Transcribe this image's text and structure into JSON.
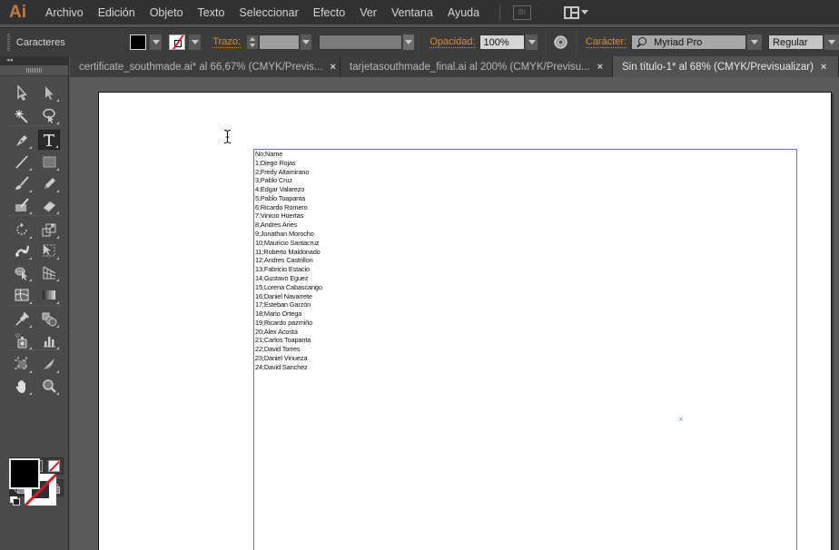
{
  "app": {
    "logo": "Ai",
    "menu": [
      "Archivo",
      "Edición",
      "Objeto",
      "Texto",
      "Seleccionar",
      "Efecto",
      "Ver",
      "Ventana",
      "Ayuda"
    ],
    "bridge_label": "Br",
    "workspace_icon": "workspace-grid-icon"
  },
  "control_bar": {
    "panel_label": "Caracteres",
    "fill_color": "#000000",
    "stroke_color": "none",
    "stroke_label": "Trazo:",
    "stroke_weight": "",
    "brush_profile": "",
    "opacity_label": "Opacidad:",
    "opacity_value": "100%",
    "recolor_icon": "recolor-artwork-icon",
    "character_label": "Carácter:",
    "font_family": "Myriad Pro",
    "font_style": "Regular",
    "accent_color": "#d98a3f"
  },
  "tabs": [
    {
      "label": "certificate_southmade.ai* al 66,67% (CMYK/Previs...",
      "active": false
    },
    {
      "label": "tarjetasouthmade_final.ai al 200% (CMYK/Previsu...",
      "active": false
    },
    {
      "label": "Sin título-1* al 68% (CMYK/Previsualizar)",
      "active": true
    }
  ],
  "tools": {
    "active_tool": "type-tool",
    "items": [
      "selection-tool",
      "direct-selection-tool",
      "magic-wand-tool",
      "lasso-tool",
      "pen-tool",
      "type-tool",
      "line-segment-tool",
      "rectangle-tool",
      "paintbrush-tool",
      "pencil-tool",
      "blob-brush-tool",
      "eraser-tool",
      "rotate-tool",
      "scale-tool",
      "puppet-warp-tool",
      "free-transform-tool",
      "shape-builder-tool",
      "perspective-grid-tool",
      "mesh-tool",
      "gradient-tool",
      "eyedropper-tool",
      "blend-tool",
      "symbol-sprayer-tool",
      "column-graph-tool",
      "artboard-tool",
      "slice-tool",
      "hand-tool",
      "zoom-tool"
    ],
    "fill_color": "#000000",
    "stroke_color": "none"
  },
  "document": {
    "text_lines": [
      "No;Name",
      "1;Diego Rojas",
      "2;Fredy Altamirano",
      "3;Pablo Cruz",
      "4;Edgar Valarezo",
      "5;Pablo Toapanta",
      "6;Ricardo Romero",
      "7;Vinicio Huertas",
      "8;Andres Aries",
      "9;Jonathan Morocho",
      "10;Mauricio Santacruz",
      "11;Roberto Maldonado",
      "12;Andres Castrillon",
      "13;Fabricio Estacio",
      "14;Gustavo Eguez",
      "15;Lorena Cabascango",
      "16;Daniel Navarrete",
      "17;Esteban Garzón",
      "18;Mario Ortega",
      "19;Ricardo pazmiño",
      "20;Alex Acosta",
      "21;Carlos Toapanta",
      "22;David Torres",
      "23;Daniel Vinueza",
      "24;David Sanchez"
    ],
    "selection_color": "#5a7ec4",
    "center_mark": "×"
  }
}
